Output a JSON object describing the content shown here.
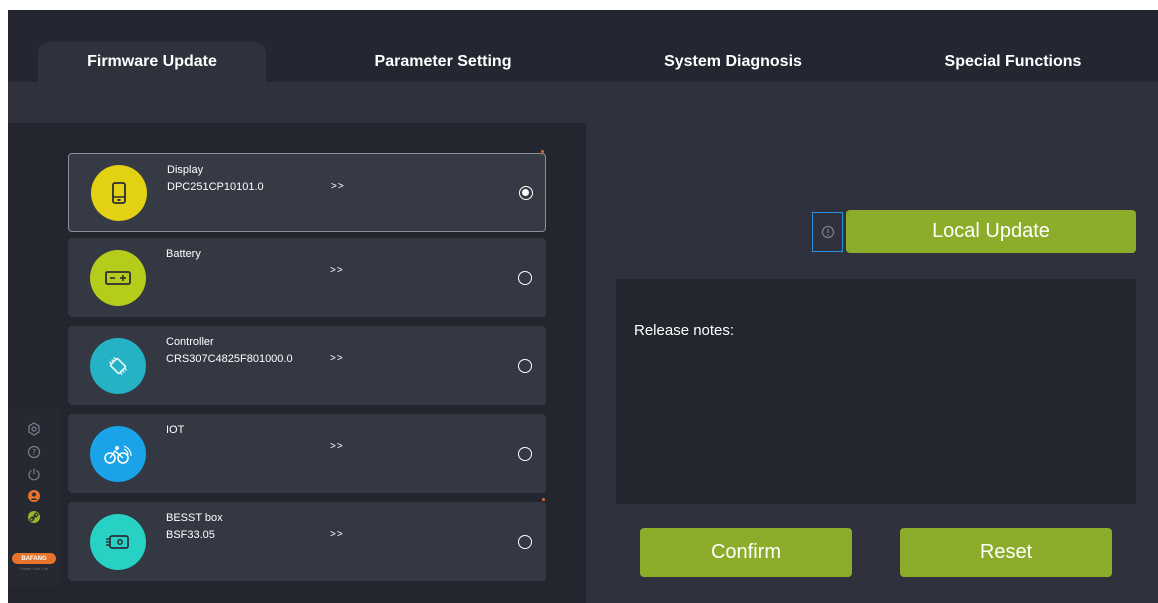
{
  "tabs": [
    {
      "label": "Firmware Update",
      "active": true
    },
    {
      "label": "Parameter Setting",
      "active": false
    },
    {
      "label": "System Diagnosis",
      "active": false
    },
    {
      "label": "Special Functions",
      "active": false
    }
  ],
  "devices": [
    {
      "name": "Display",
      "version": "DPC251CP10101.0",
      "arrow": ">>",
      "selected": true,
      "icon": "display-icon",
      "color": "#e3d114"
    },
    {
      "name": "Battery",
      "version": "",
      "arrow": ">>",
      "selected": false,
      "icon": "battery-icon",
      "color": "#b5cc1a"
    },
    {
      "name": "Controller",
      "version": "CRS307C4825F801000.0",
      "arrow": ">>",
      "selected": false,
      "icon": "controller-icon",
      "color": "#25b2c4"
    },
    {
      "name": "IOT",
      "version": "",
      "arrow": ">>",
      "selected": false,
      "icon": "iot-bike-icon",
      "color": "#1aa3e8"
    },
    {
      "name": "BESST box",
      "version": "BSF33.05",
      "arrow": ">>",
      "selected": false,
      "icon": "besst-box-icon",
      "color": "#27d1c4"
    }
  ],
  "rail": {
    "icons": [
      "settings-icon",
      "help-icon",
      "power-icon",
      "user-icon",
      "link-icon"
    ],
    "brand": "BAFANG",
    "brand_tagline": "Power Your Life"
  },
  "right": {
    "local_update_label": "Local Update",
    "release_notes_label": "Release notes:",
    "confirm_label": "Confirm",
    "reset_label": "Reset"
  },
  "colors": {
    "accent_green": "#8cad2a",
    "info_border": "#2b8fe0",
    "brand_orange": "#e8742b"
  }
}
